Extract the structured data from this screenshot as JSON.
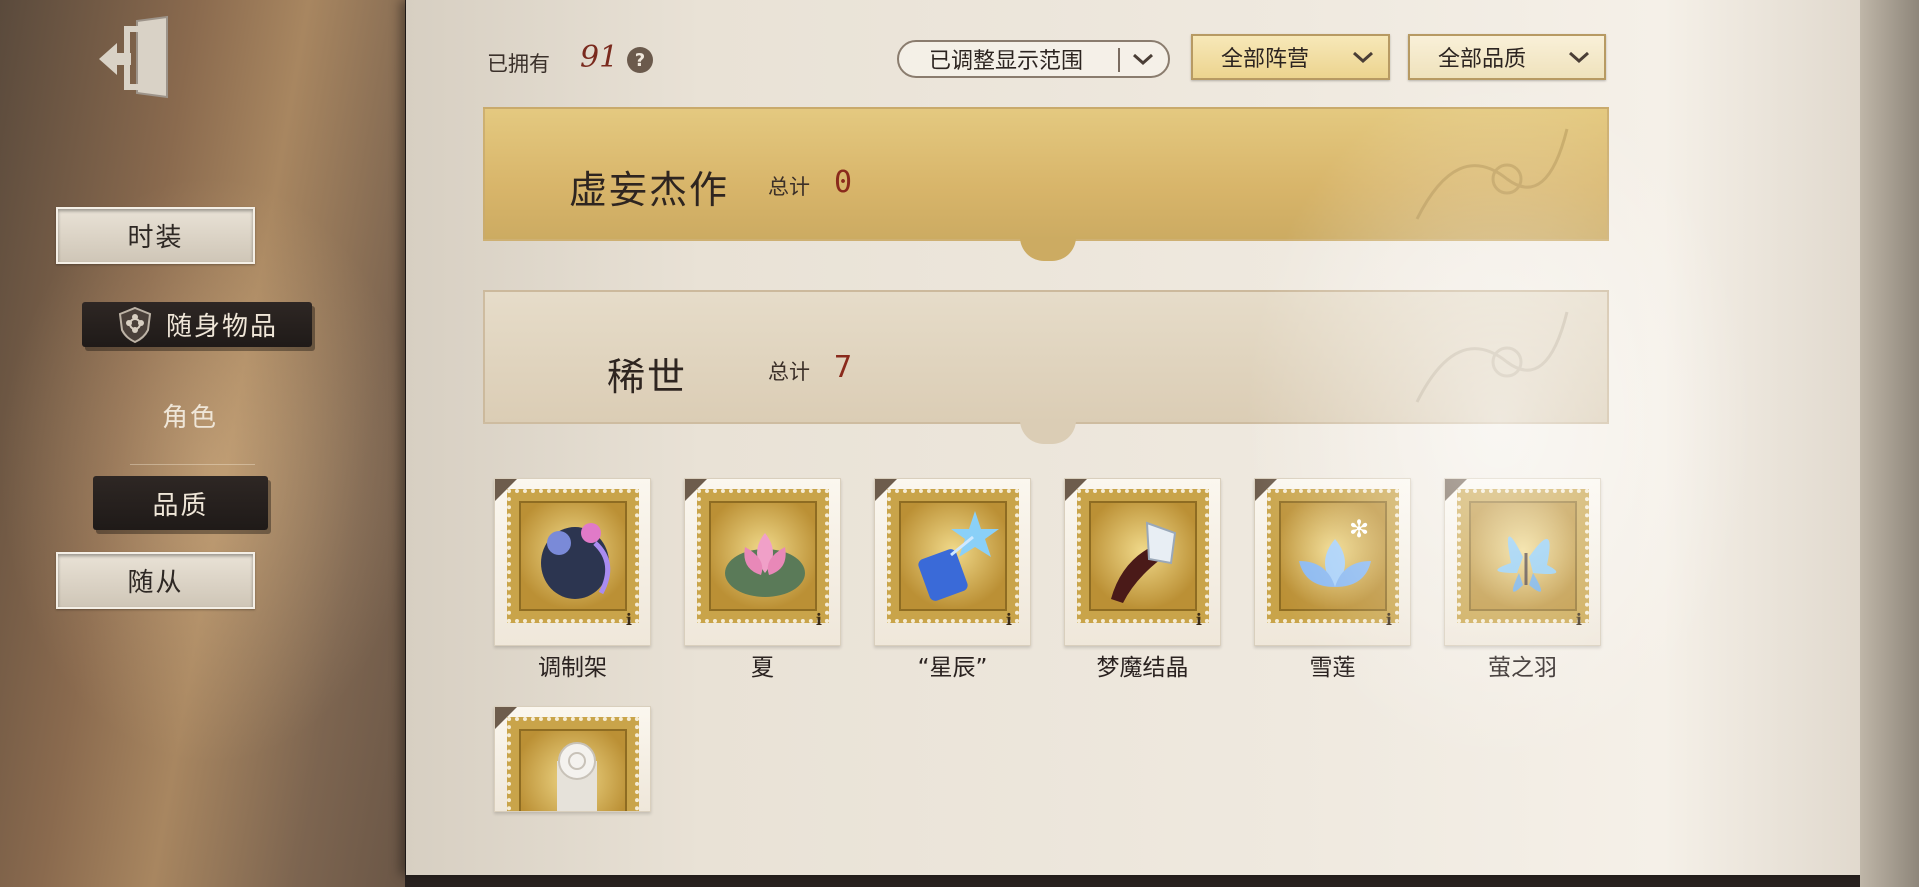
{
  "sidebar": {
    "exit_icon": "exit-door-icon",
    "items": [
      {
        "label": "时装",
        "style": "light"
      },
      {
        "label": "随身物品",
        "style": "dark-selected",
        "icon": "shield-flower-icon"
      },
      {
        "label": "角色",
        "style": "plain"
      },
      {
        "label": "品质",
        "style": "dark"
      },
      {
        "label": "随从",
        "style": "light"
      }
    ]
  },
  "header": {
    "owned_label": "已拥有",
    "owned_count": "91",
    "help_icon": "question-mark-icon",
    "filters": {
      "display_range": "已调整显示范围",
      "faction": "全部阵营",
      "quality": "全部品质"
    }
  },
  "categories": [
    {
      "title": "虚妄杰作",
      "total_label": "总计",
      "total": "0",
      "color": "#d8b56a"
    },
    {
      "title": "稀世",
      "total_label": "总计",
      "total": "7",
      "color": "#dbcdb5"
    }
  ],
  "items": [
    {
      "name": "调制架",
      "icon": "alchemy-rack-icon",
      "price_glyph": "ℹ"
    },
    {
      "name": "夏",
      "icon": "lotus-icon",
      "price_glyph": "ℹ"
    },
    {
      "name": "“星辰”",
      "icon": "star-lantern-icon",
      "price_glyph": "ℹ"
    },
    {
      "name": "梦魔结晶",
      "icon": "crystal-shard-icon",
      "price_glyph": "ℹ"
    },
    {
      "name": "雪莲",
      "icon": "snow-lotus-icon",
      "price_glyph": "ℹ"
    },
    {
      "name": "萤之羽",
      "icon": "blue-butterfly-icon",
      "price_glyph": "ℹ"
    },
    {
      "name": "",
      "icon": "white-rose-icon",
      "price_glyph": ""
    }
  ],
  "colors": {
    "accent_red": "#8a2a1c",
    "gold": "#c9a44a"
  }
}
